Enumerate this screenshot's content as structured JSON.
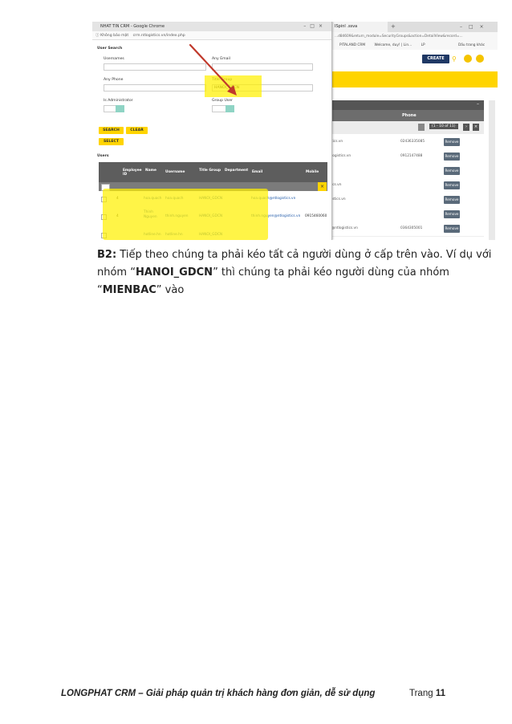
{
  "colors": {
    "accent": "#ffd400",
    "highlight": "#fff000",
    "arrow": "#c0392b",
    "link": "#1e58a8"
  },
  "screenshot": {
    "popup": {
      "window_title": "NHAT TIN CRM - Google Chrome",
      "security_label": "Không bảo mật",
      "url": "crm.ntlogistics.vn/index.php",
      "section_title": "User Search",
      "fields": {
        "usernames_label": "Usernames",
        "any_email_label": "Any Email",
        "any_phone_label": "Any Phone",
        "title_group_label": "Title Group",
        "title_group_value": "HANOI_GDCN",
        "is_admin_label": "Is Administrator",
        "group_user_label": "Group User"
      },
      "buttons": {
        "search": "SEARCH",
        "clear": "CLEAR",
        "select": "SELECT"
      },
      "users_label": "Users",
      "table": {
        "headers": [
          "Employee ID",
          "Name",
          "Username",
          "Title Group",
          "Department",
          "Email",
          "Mobile"
        ],
        "rows": [
          {
            "id": "4",
            "name": "hoa.quach",
            "username": "hoa.quach",
            "title_group": "HANOI_GDCN",
            "email": "hoa.quach@ntlogistics.vn",
            "mobile": ""
          },
          {
            "id": "4",
            "name": "Thinh Nguyen",
            "username": "thinh.nguyen",
            "title_group": "HANOI_GDCN",
            "email": "thinh.nguyen@ntlogistics.vn",
            "mobile": "0915460060"
          },
          {
            "id": "",
            "name": "hotline.hn",
            "username": "hotline.hn",
            "title_group": "HANOI_GDCN",
            "email": "",
            "mobile": ""
          }
        ]
      }
    },
    "background": {
      "tab_title": "ISpinl .ssva",
      "url": "...d84609&return_module=SecurityGroups&action=DetailView&record=...",
      "bookmarks": [
        "PITALAND CRM",
        "Welcome, duy! | Lin...",
        "LP",
        "Dấu trang khác"
      ],
      "create_label": "CREATE",
      "phone_header": "Phone",
      "pager": "(1 - 10 of 11)",
      "remove_label": "Remove",
      "rows": [
        {
          "email": "tics.vn",
          "phone": "02436335085"
        },
        {
          "email": "logistics.vn",
          "phone": "0912147488"
        },
        {
          "email": "",
          "phone": ""
        },
        {
          "email": "ics.vn",
          "phone": ""
        },
        {
          "email": "istics.vn",
          "phone": ""
        },
        {
          "email": "",
          "phone": ""
        },
        {
          "email": "@ntlogistics.vn",
          "phone": "0364305001"
        },
        {
          "email": "",
          "phone": ""
        }
      ]
    }
  },
  "instruction": {
    "step": "B2:",
    "line1": " Tiếp theo chúng ta phải kéo tất cả người dùng ở cấp trên vào. Ví dụ  với",
    "line2_pre": "nhóm “",
    "group_source": "HANOI_GDCN",
    "line2_post": "” thì chúng ta phải kéo người dùng của nhóm",
    "line3_pre": "“",
    "group_target": "MIENBAC",
    "line3_post": "” vào"
  },
  "footer": {
    "title": "LONGPHAT CRM – Giải pháp quản trị khách hàng đơn giản, dễ sử dụng",
    "page_label": "Trang ",
    "page_number": "11"
  }
}
